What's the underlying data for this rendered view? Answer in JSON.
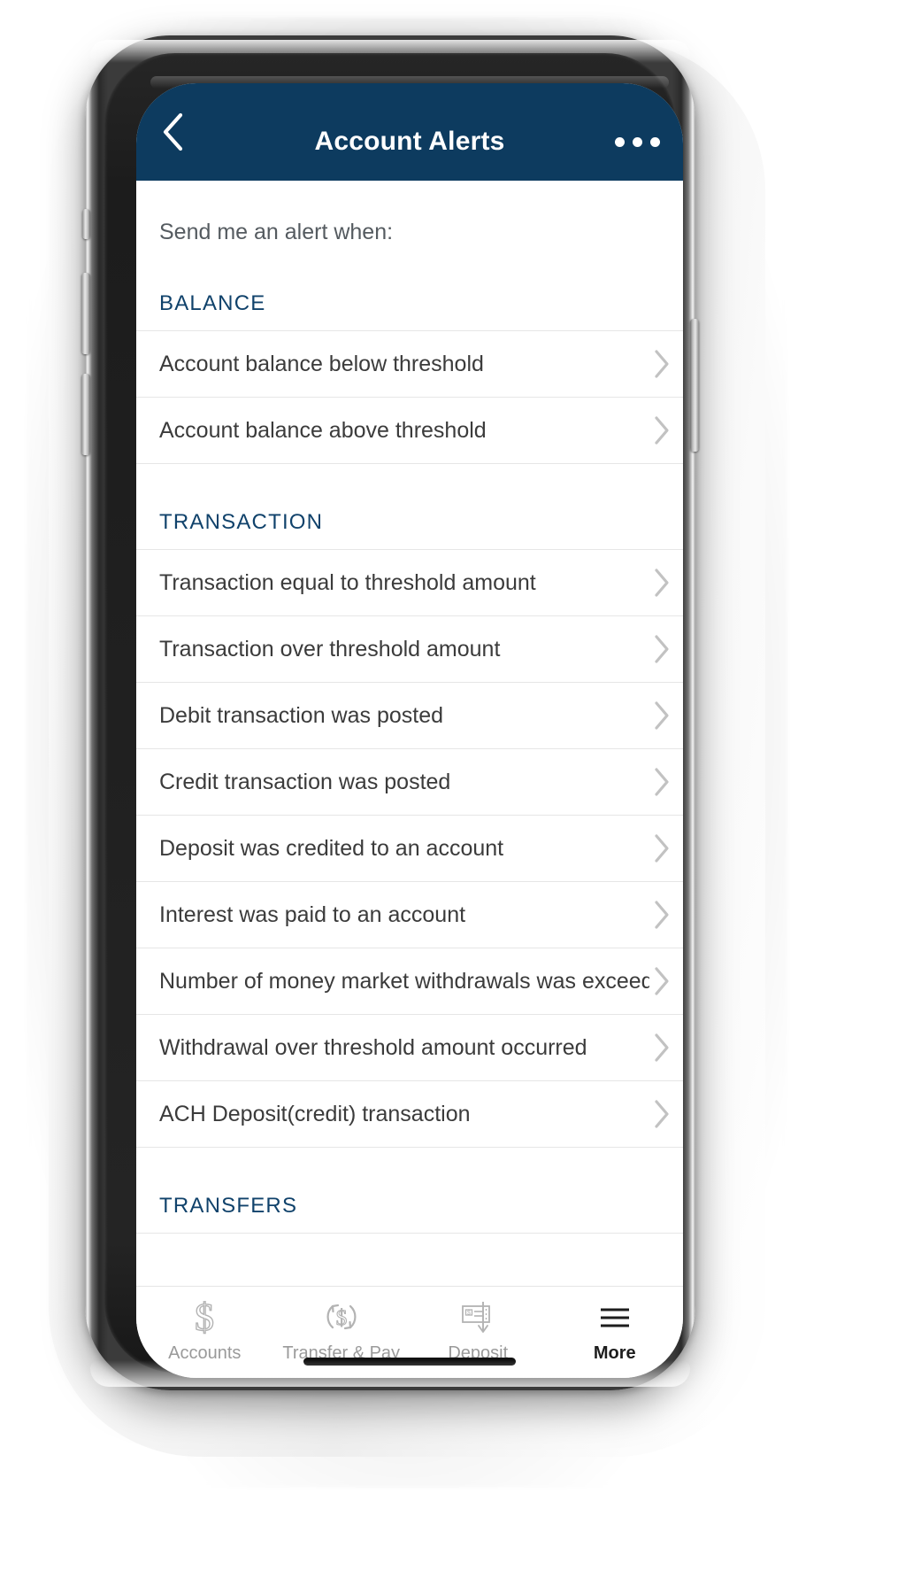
{
  "colors": {
    "navy": "#0d3b5f",
    "section_header": "#10426b",
    "row_text": "#3b3b3b",
    "chevron": "#c2c2c2",
    "tab_inactive": "#9a9a9a",
    "tab_active": "#1d1d1d"
  },
  "navbar": {
    "back_icon": "chevron-left-icon",
    "title": "Account Alerts",
    "more_icon": "ellipsis-icon"
  },
  "content": {
    "lead_text": "Send me an alert when:",
    "sections": [
      {
        "header": "BALANCE",
        "rows": [
          {
            "label": "Account balance below threshold",
            "chevron": "chevron-right-icon"
          },
          {
            "label": "Account balance above threshold",
            "chevron": "chevron-right-icon"
          }
        ]
      },
      {
        "header": "TRANSACTION",
        "rows": [
          {
            "label": "Transaction equal to threshold amount",
            "chevron": "chevron-right-icon"
          },
          {
            "label": "Transaction over threshold amount",
            "chevron": "chevron-right-icon"
          },
          {
            "label": "Debit transaction was posted",
            "chevron": "chevron-right-icon"
          },
          {
            "label": "Credit transaction was posted",
            "chevron": "chevron-right-icon"
          },
          {
            "label": "Deposit was credited to an account",
            "chevron": "chevron-right-icon"
          },
          {
            "label": "Interest was paid to an account",
            "chevron": "chevron-right-icon"
          },
          {
            "label": "Number of money market withdrawals was exceeded",
            "chevron": "chevron-right-icon"
          },
          {
            "label": "Withdrawal over threshold amount occurred",
            "chevron": "chevron-right-icon"
          },
          {
            "label": "ACH Deposit(credit) transaction",
            "chevron": "chevron-right-icon"
          }
        ]
      },
      {
        "header": "TRANSFERS",
        "rows": []
      }
    ]
  },
  "tabbar": {
    "tabs": [
      {
        "label": "Accounts",
        "icon": "dollar-sign-icon",
        "active": false
      },
      {
        "label": "Transfer & Pay",
        "icon": "transfer-circular-arrows-dollar-icon",
        "active": false
      },
      {
        "label": "Deposit",
        "icon": "check-deposit-arrow-icon",
        "active": false
      },
      {
        "label": "More",
        "icon": "hamburger-menu-icon",
        "active": true
      }
    ]
  }
}
